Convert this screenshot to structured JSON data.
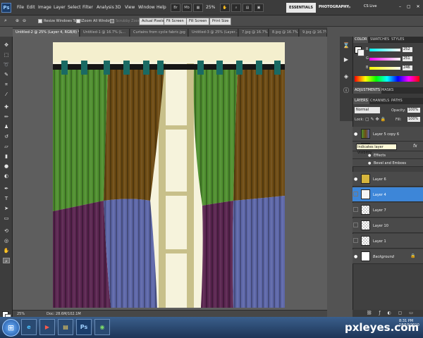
{
  "app": {
    "logo": "Ps"
  },
  "menu": [
    "File",
    "Edit",
    "Image",
    "Layer",
    "Select",
    "Filter",
    "Analysis",
    "3D",
    "View",
    "Window",
    "Help"
  ],
  "menubar": {
    "zoom": "25%",
    "workspace_active": "ESSENTIALS",
    "workspace_other": "PHOTOGRAPHY",
    "more": "»",
    "cs_live": "CS Live",
    "window_controls": "– ▢ ✕"
  },
  "options": {
    "resize_windows": "Resize Windows To Fit",
    "zoom_all": "Zoom All Windows",
    "scrubby_zoom": "Scrubby Zoom",
    "buttons": [
      "Actual Pixels",
      "Fit Screen",
      "Fill Screen",
      "Print Size"
    ]
  },
  "tabs": [
    "Untitled-2 @ 25% (Layer 4, RGB/8) *",
    "Untitled-1 @ 16.7% (L...",
    "Curtains from cycle fabric.jpg",
    "Untitled-3 @ 25% (Layer...",
    "7.jpg @ 16.7% (RG...",
    "8.jpg @ 16.7% (RG...",
    "9.jpg @ 16.7% (RG..."
  ],
  "status": {
    "zoom": "25%",
    "doc": "Doc: 28.6M/102.1M"
  },
  "panels": {
    "color_tabs": [
      "COLOR",
      "SWATCHES",
      "STYLES"
    ],
    "adjust_tabs": [
      "ADJUSTMENTS",
      "MASKS"
    ],
    "layer_tabs": [
      "LAYERS",
      "CHANNELS",
      "PATHS"
    ],
    "blend_mode": "Normal",
    "opacity_label": "Opacity:",
    "opacity": "100%",
    "lock_label": "Lock:",
    "fill_label": "Fill:",
    "fill": "100%",
    "r_label": "R",
    "r_value": "252",
    "g_label": "G",
    "g_value": "251",
    "b_label": "B",
    "b_value": "246"
  },
  "layers": [
    {
      "name": "Layer 5 copy 6"
    },
    {
      "name": "Effects"
    },
    {
      "name": "Bevel and Emboss"
    },
    {
      "name": "Layer 6"
    },
    {
      "name": "Layer 4"
    },
    {
      "name": "Layer 7"
    },
    {
      "name": "Layer 10"
    },
    {
      "name": "Layer 1"
    },
    {
      "name": "Background"
    }
  ],
  "layer_fx": "fx",
  "tooltip": "Indicates layer visibility",
  "watermark": "pxleyes.com",
  "tray": {
    "time": "8:31 PM",
    "date": "18/10/2010"
  },
  "colors": {
    "green": "#4f8f2f",
    "brown": "#6d4b14",
    "purple": "#5a2550",
    "blue": "#5d67a8",
    "teal": "#1a6a63",
    "cream": "#f4efce",
    "selected_layer": "#3d86d8"
  }
}
